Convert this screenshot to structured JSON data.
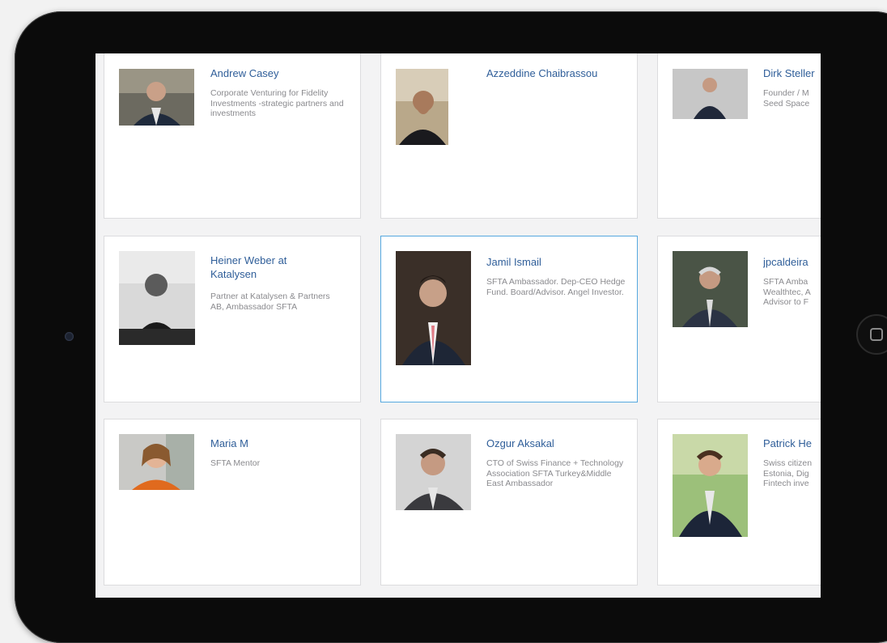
{
  "profiles": [
    {
      "name": "Andrew Casey",
      "description": "Corporate Venturing for Fidelity Investments -strategic partners and investments"
    },
    {
      "name": "Azzeddine Chaibrassou",
      "description": ""
    },
    {
      "name": "Dirk Steller",
      "description": "Founder / M Seed Space"
    },
    {
      "name": "Heiner Weber at Katalysen",
      "description": "Partner at Katalysen & Partners AB, Ambassador SFTA"
    },
    {
      "name": "Jamil Ismail",
      "description": "SFTA Ambassador. Dep-CEO Hedge Fund. Board/Advisor. Angel Investor."
    },
    {
      "name": "jpcaldeira",
      "description": "SFTA Amba Wealthtec, A Advisor to F"
    },
    {
      "name": "Maria M",
      "description": "SFTA Mentor"
    },
    {
      "name": "Ozgur Aksakal",
      "description": "CTO of Swiss Finance + Technology Association SFTA Turkey&Middle East Ambassador"
    },
    {
      "name": "Patrick He",
      "description": "Swiss citizen Estonia, Dig Fintech inve"
    }
  ]
}
